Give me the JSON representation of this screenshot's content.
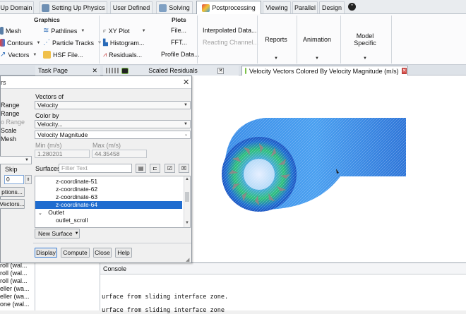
{
  "tabs": [
    {
      "label": "Up Domain",
      "icon": ""
    },
    {
      "label": "Setting Up Physics",
      "icon": "physics-icon"
    },
    {
      "label": "User Defined",
      "icon": ""
    },
    {
      "label": "Solving",
      "icon": "solving-icon"
    },
    {
      "label": "Postprocessing",
      "icon": "postprocessing-icon",
      "active": true
    },
    {
      "label": "Viewing",
      "icon": ""
    },
    {
      "label": "Parallel",
      "icon": ""
    },
    {
      "label": "Design",
      "icon": ""
    }
  ],
  "ribbon": {
    "graphics_title": "Graphics",
    "graphics": {
      "mesh": "Mesh",
      "contours": "Contours",
      "vectors": "Vectors",
      "pathlines": "Pathlines",
      "particle_tracks": "Particle Tracks",
      "hsf_file": "HSF File..."
    },
    "plots_title": "Plots",
    "plots": {
      "xy_plot": "XY Plot",
      "histogram": "Histogram...",
      "residuals": "Residuals...",
      "file": "File...",
      "fft": "FFT...",
      "profile_data": "Profile Data...",
      "interpolated_data": "Interpolated Data...",
      "reacting_channel": "Reacting Channel..."
    },
    "reports": "Reports",
    "animation": "Animation",
    "model_specific": "Model Specific"
  },
  "strip": {
    "task_page": "Task Page",
    "scaled_residuals": "Scaled Residuals",
    "velocity_tab": "Velocity Vectors Colored By Velocity Magnitude (m/s)"
  },
  "left_panel": {
    "items": [
      "Range",
      "Range",
      "o Range",
      "Scale",
      "Mesh"
    ],
    "skip_label": "Skip",
    "skip_value": "0",
    "options_btn": "ptions...",
    "vectors_btn": "Vectors...",
    "tree_items": [
      "roll (wal...",
      "roll (wal...",
      "roll (wal...",
      "eller (wa...",
      "eller (wa...",
      "one (wal..."
    ]
  },
  "dialog": {
    "title": "rs",
    "vectors_of_label": "Vectors of",
    "vectors_of_value": "Velocity",
    "color_by_label": "Color by",
    "color_by_value": "Velocity...",
    "color_by_sub": "Velocity Magnitude",
    "min_label": "Min (m/s)",
    "min_value": "1.280201",
    "max_label": "Max (m/s)",
    "max_value": "44.35458",
    "surfaces_label": "Surfaces",
    "filter_placeholder": "Filter Text",
    "surfaces": [
      "z-coordinate-51",
      "z-coordinate-62",
      "z-coordinate-63",
      "z-coordinate-64"
    ],
    "selected_surface": "z-coordinate-64",
    "group_outlet": "Outlet",
    "outlet_item": "outlet_scroll",
    "new_surface": "New Surface",
    "buttons": {
      "display": "Display",
      "compute": "Compute",
      "close": "Close",
      "help": "Help"
    }
  },
  "console": {
    "title": "Console",
    "lines": [
      "urface from sliding interface zone.",
      "urface from sliding interface zone"
    ]
  },
  "colors": {
    "accent": "#1f6ccf",
    "ribbon_bg": "#fbfbfc"
  }
}
